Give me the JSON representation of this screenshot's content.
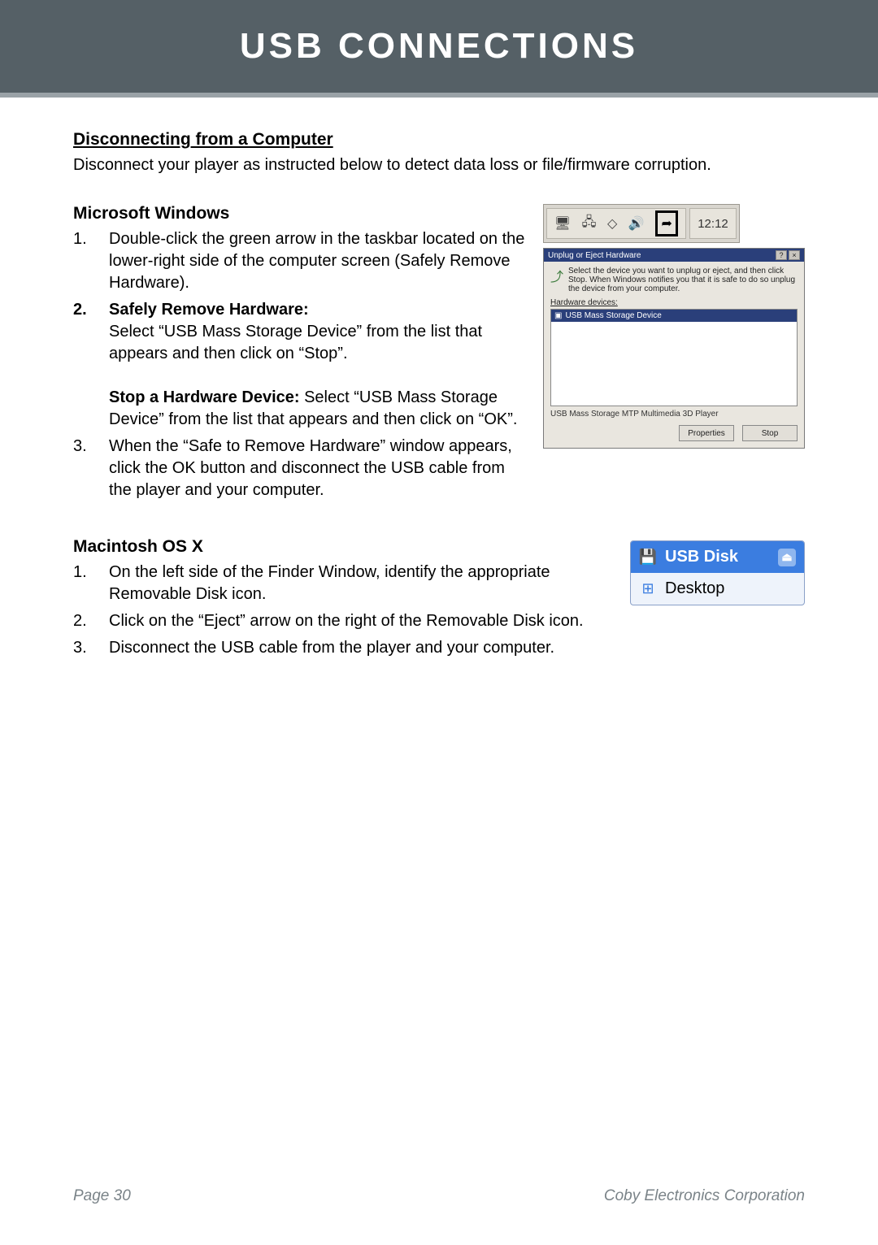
{
  "header": {
    "title": "USB CONNECTIONS"
  },
  "section": {
    "heading": "Disconnecting from a Computer",
    "intro": "Disconnect your player as instructed below to detect data loss or file/firmware corruption."
  },
  "windows": {
    "heading": "Microsoft Windows",
    "item1_num": "1.",
    "item1_text": "Double-click the green arrow in the taskbar located on the lower-right side of the computer screen (Safely Remove Hardware).",
    "item2_num": "2.",
    "item2_label": "Safely Remove Hardware:",
    "item2_text_a": "Select “USB Mass Storage Device” from the list that appears and then click on “Stop”.",
    "item2_bold_b": "Stop a Hardware Device:",
    "item2_text_b": " Select “USB Mass Storage Device” from the list that appears and then click on “OK”.",
    "item3_num": "3.",
    "item3_text": "When the “Safe to Remove Hardware” window appears, click the OK button and disconnect the USB cable from the player and your computer."
  },
  "taskbar": {
    "clock": "12:12"
  },
  "dialog": {
    "title": "Unplug or Eject Hardware",
    "instruction": "Select the device you want to unplug or eject, and then click Stop. When Windows notifies you that it is safe to do so unplug the device from your computer.",
    "devices_label": "Hardware devices:",
    "selected_item": "USB Mass Storage Device",
    "under_text": "USB Mass Storage MTP Multimedia 3D Player",
    "btn_props": "Properties",
    "btn_stop": "Stop"
  },
  "mac": {
    "heading": "Macintosh OS X",
    "item1_num": "1.",
    "item1_text": "On the left side of the Finder Window, identify the appropriate Removable Disk icon.",
    "item2_num": "2.",
    "item2_text": "Click on the “Eject” arrow on the right of the Removable Disk icon.",
    "item3_num": "3.",
    "item3_text": "Disconnect the USB cable from the player and your computer.",
    "usb_disk": "USB Disk",
    "desktop": "Desktop"
  },
  "footer": {
    "page": "Page 30",
    "company": "Coby Electronics Corporation"
  }
}
